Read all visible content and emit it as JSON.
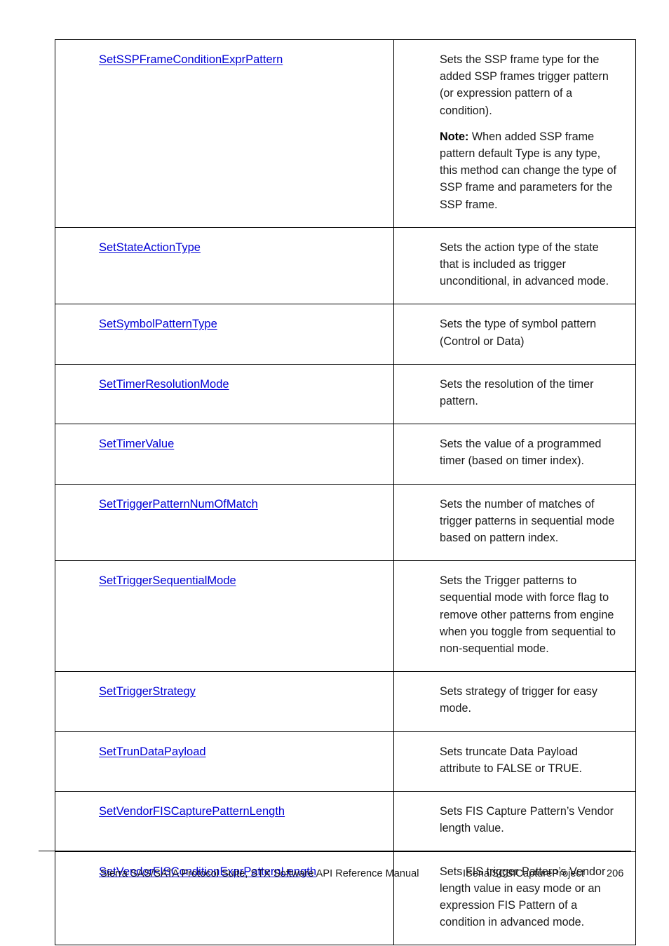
{
  "document": {
    "table": {
      "rows": [
        {
          "method": "SetSSPFrameConditionExprPattern",
          "description_paragraphs": [
            {
              "bold_prefix": "",
              "text": "Sets the SSP frame type for the added SSP frames trigger pattern (or expression pattern of a condition)."
            },
            {
              "bold_prefix": "Note:",
              "text": " When added SSP frame pattern default Type is any type, this method can change the type of SSP frame and parameters for the SSP frame."
            }
          ]
        },
        {
          "method": "SetStateActionType",
          "description_paragraphs": [
            {
              "bold_prefix": "",
              "text": "Sets the action type of the state that is included as trigger unconditional, in advanced mode."
            }
          ]
        },
        {
          "method": "SetSymbolPatternType",
          "description_paragraphs": [
            {
              "bold_prefix": "",
              "text": "Sets the type of symbol pattern (Control or Data)"
            }
          ]
        },
        {
          "method": "SetTimerResolutionMode",
          "description_paragraphs": [
            {
              "bold_prefix": "",
              "text": "Sets the resolution of the timer pattern."
            }
          ]
        },
        {
          "method": "SetTimerValue",
          "description_paragraphs": [
            {
              "bold_prefix": "",
              "text": "Sets the value of a programmed timer (based on timer index)."
            }
          ]
        },
        {
          "method": "SetTriggerPatternNumOfMatch",
          "description_paragraphs": [
            {
              "bold_prefix": "",
              "text": "Sets the number of matches of trigger patterns in sequential mode based on pattern index."
            }
          ]
        },
        {
          "method": "SetTriggerSequentialMode",
          "description_paragraphs": [
            {
              "bold_prefix": "",
              "text": "Sets the Trigger patterns to sequential mode with force flag to remove other patterns from engine when you toggle from sequential to non-sequential mode."
            }
          ]
        },
        {
          "method": "SetTriggerStrategy",
          "description_paragraphs": [
            {
              "bold_prefix": "",
              "text": "Sets strategy of trigger for easy mode."
            }
          ]
        },
        {
          "method": "SetTrunDataPayload",
          "description_paragraphs": [
            {
              "bold_prefix": "",
              "text": "Sets truncate Data Payload attribute to FALSE or TRUE."
            }
          ]
        },
        {
          "method": "SetVendorFISCapturePatternLength",
          "description_paragraphs": [
            {
              "bold_prefix": "",
              "text": "Sets FIS Capture Pattern’s Vendor length value."
            }
          ]
        },
        {
          "method": "SetVendorFISConditionExprPatternLength",
          "description_paragraphs": [
            {
              "bold_prefix": "",
              "text": "Sets FIS trigger Pattern’s Vendor length value in easy mode or an expression FIS Pattern of a condition in advanced mode."
            }
          ]
        }
      ]
    },
    "footer": {
      "manual_title": "Sierra SAS/SATA Protocol Suite, STX Software API Reference Manual",
      "section": "ISerialSCSICaptureProject",
      "page_number": "206"
    },
    "colors": {
      "link": "#0000d6",
      "text": "#1a1a1a",
      "border": "#000000"
    }
  }
}
